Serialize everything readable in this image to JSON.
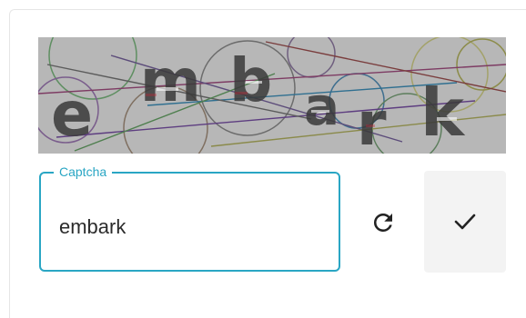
{
  "captcha": {
    "image_text": "embark",
    "field_label": "Captcha",
    "field_value": "embark"
  },
  "icons": {
    "refresh": "refresh-icon",
    "submit": "checkmark-icon"
  },
  "colors": {
    "accent": "#2aa6c4",
    "captcha_background": "#b7b7b7",
    "submit_background": "#f3f3f3",
    "text": "#2b2b2b"
  }
}
